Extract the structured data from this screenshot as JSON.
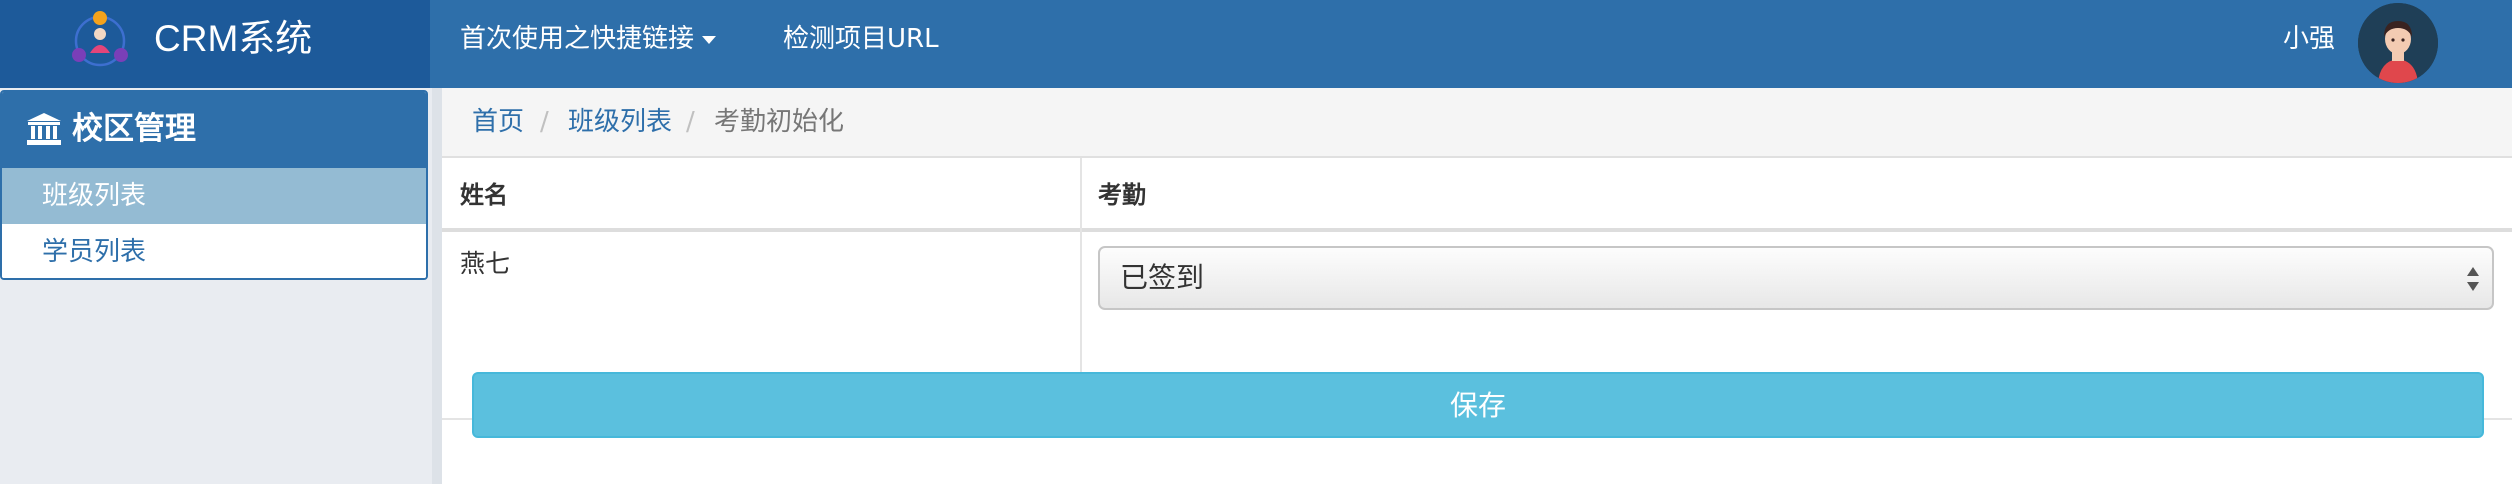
{
  "navbar": {
    "brand": "CRM系统",
    "quick_links_label": "首次使用之快捷链接",
    "detect_url_label": "检测项目URL",
    "user_name": "小强"
  },
  "sidebar": {
    "title": "校区管理",
    "items": [
      {
        "label": "班级列表",
        "active": true
      },
      {
        "label": "学员列表",
        "active": false
      }
    ]
  },
  "breadcrumb": {
    "home": "首页",
    "class_list": "班级列表",
    "current": "考勤初始化",
    "separator": "/"
  },
  "table": {
    "headers": [
      "姓名",
      "考勤"
    ],
    "rows": [
      {
        "name": "燕七",
        "attendance": "已签到"
      }
    ]
  },
  "save_label": "保存",
  "colors": {
    "primary": "#2e6faa",
    "brand_bg": "#1d5a9a",
    "sidebar_active": "#94bbd3",
    "info_button": "#5bc0de"
  },
  "icons": {
    "logo": "team-logo-icon",
    "sidebar": "bank-icon",
    "caret": "caret-down-icon",
    "select": "select-arrows-icon"
  }
}
